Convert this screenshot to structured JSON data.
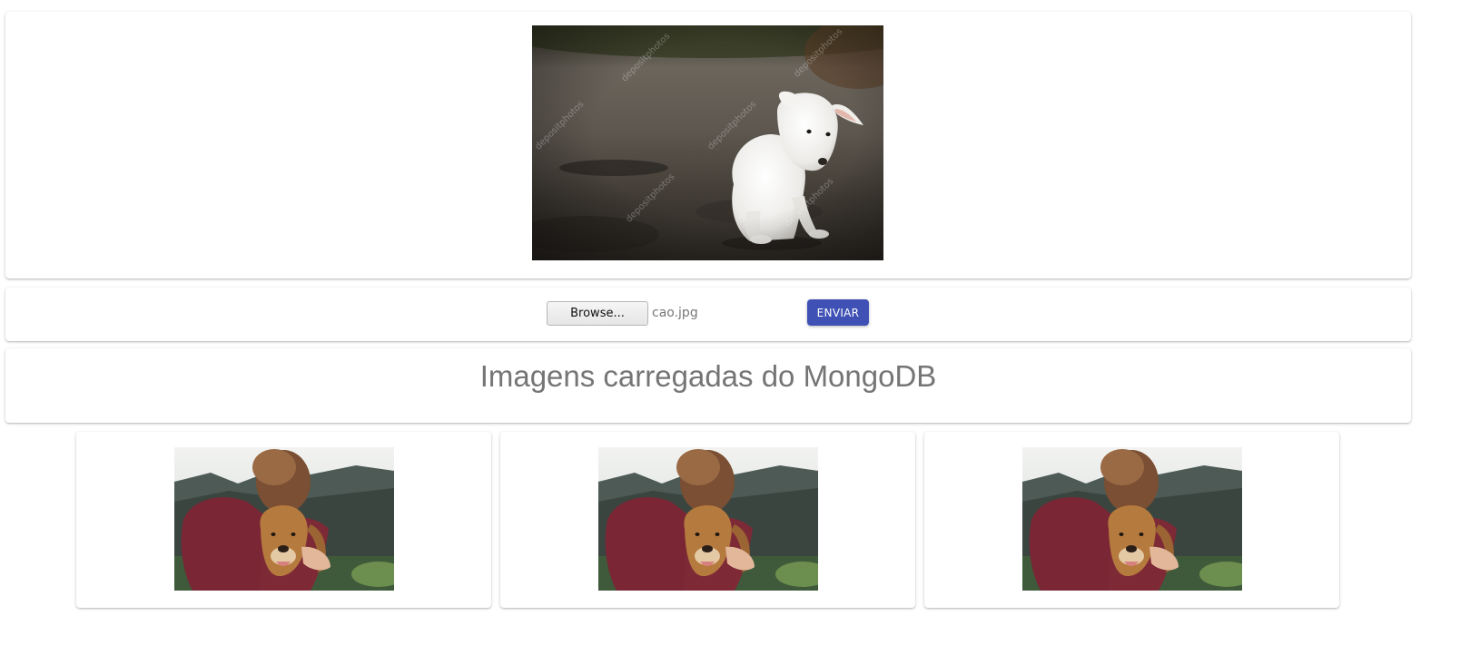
{
  "preview": {
    "image_alt": "Filhote de cachorro branco sentado no chão",
    "watermark": "depositphotos"
  },
  "upload": {
    "browse_label": "Browse...",
    "file_name": "cao.jpg",
    "submit_label": "ENVIAR"
  },
  "heading": {
    "title": "Imagens carregadas do MongoDB"
  },
  "gallery": {
    "items": [
      {
        "image_alt": "Homem abraçando um cachorro golden retriever"
      },
      {
        "image_alt": "Homem abraçando um cachorro golden retriever"
      },
      {
        "image_alt": "Homem abraçando um cachorro golden retriever"
      }
    ]
  },
  "colors": {
    "accent": "#3f51b5",
    "heading_text": "#757575",
    "file_name_text": "#777777"
  }
}
